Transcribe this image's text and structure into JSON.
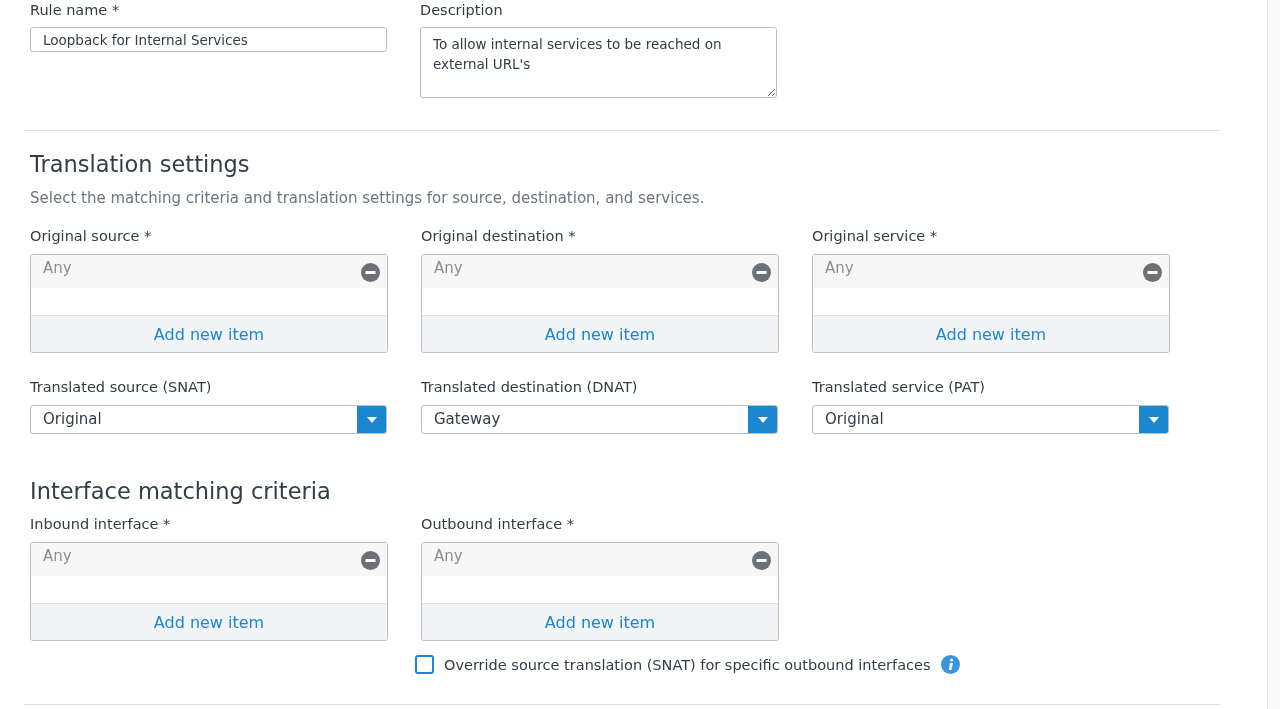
{
  "rule_name": {
    "label": "Rule name *",
    "value": "Loopback for Internal Services"
  },
  "description": {
    "label": "Description",
    "value": "To allow internal services to be reached on external URL's"
  },
  "translation_settings": {
    "title": "Translation settings",
    "subtitle": "Select the matching criteria and translation settings for source, destination, and services.",
    "original": [
      {
        "label": "Original source *",
        "items": [
          "Any"
        ],
        "add_label": "Add new item"
      },
      {
        "label": "Original destination *",
        "items": [
          "Any"
        ],
        "add_label": "Add new item"
      },
      {
        "label": "Original service *",
        "items": [
          "Any"
        ],
        "add_label": "Add new item"
      }
    ],
    "translated": [
      {
        "label": "Translated source (SNAT)",
        "value": "Original"
      },
      {
        "label": "Translated destination (DNAT)",
        "value": "Gateway"
      },
      {
        "label": "Translated service (PAT)",
        "value": "Original"
      }
    ]
  },
  "interface_matching": {
    "title": "Interface matching criteria",
    "pickers": [
      {
        "label": "Inbound interface *",
        "items": [
          "Any"
        ],
        "add_label": "Add new item"
      },
      {
        "label": "Outbound interface *",
        "items": [
          "Any"
        ],
        "add_label": "Add new item"
      }
    ],
    "override": {
      "label": "Override source translation (SNAT) for specific outbound interfaces",
      "checked": false
    }
  }
}
